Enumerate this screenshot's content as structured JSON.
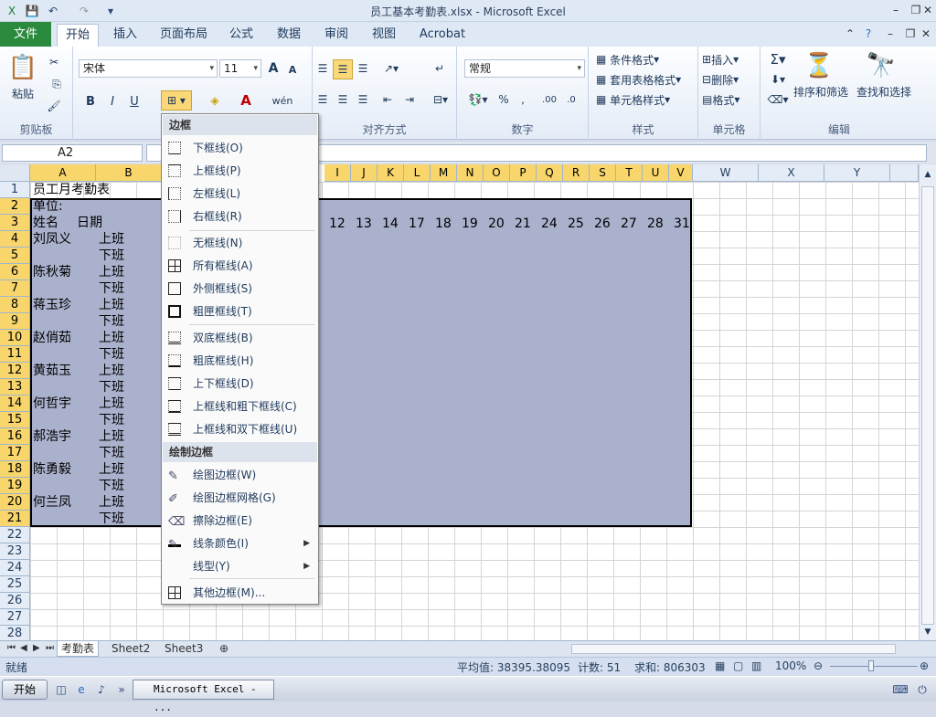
{
  "window": {
    "title": "员工基本考勤表.xlsx - Microsoft Excel"
  },
  "tabs": [
    "文件",
    "开始",
    "插入",
    "页面布局",
    "公式",
    "数据",
    "审阅",
    "视图",
    "Acrobat"
  ],
  "ribbon": {
    "clipboard": {
      "paste": "粘贴",
      "label": "剪贴板"
    },
    "font": {
      "name": "宋体",
      "size": "11"
    },
    "alignment": {
      "label": "对齐方式"
    },
    "number": {
      "format": "常规",
      "label": "数字"
    },
    "styles": {
      "conditional": "条件格式",
      "table": "套用表格格式",
      "cell": "单元格样式",
      "label": "样式"
    },
    "cells": {
      "insert": "插入",
      "delete": "删除",
      "format": "格式",
      "label": "单元格"
    },
    "editing": {
      "sort": "排序和筛选",
      "find": "查找和选择",
      "label": "编辑"
    }
  },
  "formula_bar": {
    "name_box": "A2"
  },
  "columns": [
    "A",
    "B",
    "I",
    "J",
    "K",
    "L",
    "M",
    "N",
    "O",
    "P",
    "Q",
    "R",
    "S",
    "T",
    "U",
    "V",
    "W",
    "X",
    "Y"
  ],
  "rows": [
    "1",
    "2",
    "3",
    "4",
    "5",
    "6",
    "7",
    "8",
    "9",
    "10",
    "11",
    "12",
    "13",
    "14",
    "15",
    "16",
    "17",
    "18",
    "19",
    "20",
    "21",
    "22",
    "23",
    "24",
    "25",
    "26",
    "27",
    "28"
  ],
  "cells": {
    "title": "员工月考勤表",
    "unit": "单位:",
    "name_hdr": "姓名",
    "date_hdr": "日期",
    "days": [
      "12",
      "13",
      "14",
      "17",
      "18",
      "19",
      "20",
      "21",
      "24",
      "25",
      "26",
      "27",
      "28",
      "31"
    ],
    "names": [
      "刘凤义",
      "陈秋菊",
      "蒋玉珍",
      "赵俏茹",
      "黄茹玉",
      "何哲宇",
      "郝浩宇",
      "陈勇毅",
      "何兰凤"
    ],
    "shift_on": "上班",
    "shift_off": "下班"
  },
  "border_menu": {
    "header1": "边框",
    "items1": [
      "下框线(O)",
      "上框线(P)",
      "左框线(L)",
      "右框线(R)",
      "无框线(N)",
      "所有框线(A)",
      "外侧框线(S)",
      "粗匣框线(T)",
      "双底框线(B)",
      "粗底框线(H)",
      "上下框线(D)",
      "上框线和粗下框线(C)",
      "上框线和双下框线(U)"
    ],
    "header2": "绘制边框",
    "items2": [
      "绘图边框(W)",
      "绘图边框网格(G)",
      "擦除边框(E)",
      "线条颜色(I)",
      "线型(Y)",
      "其他边框(M)..."
    ]
  },
  "sheets": [
    "考勤表",
    "Sheet2",
    "Sheet3"
  ],
  "status": {
    "ready": "就绪",
    "average": "平均值: 38395.38095",
    "count": "计数: 51",
    "sum": "求和: 806303",
    "zoom": "100%"
  },
  "taskbar": {
    "start": "开始",
    "app": "Microsoft Excel - ..."
  }
}
